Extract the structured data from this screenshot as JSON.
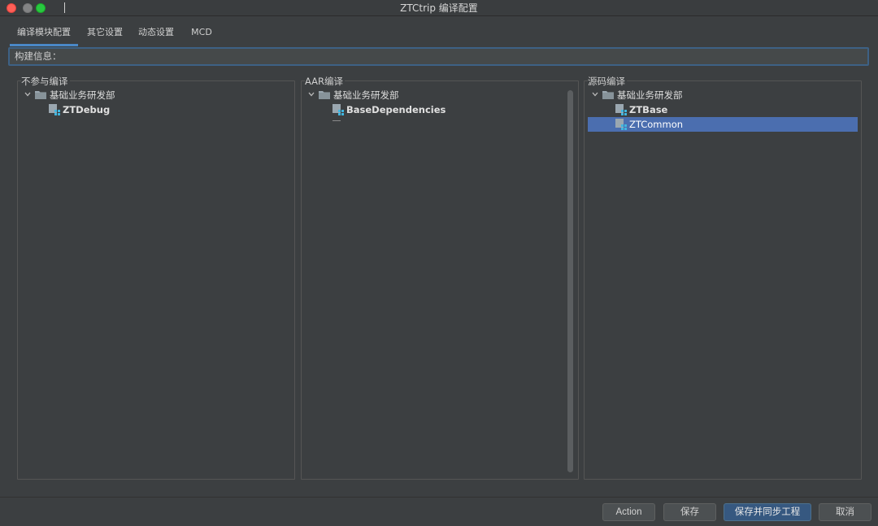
{
  "window": {
    "title": "ZTCtrip 编译配置"
  },
  "tabs": [
    {
      "label": "编译模块配置",
      "active": true
    },
    {
      "label": "其它设置",
      "active": false
    },
    {
      "label": "动态设置",
      "active": false
    },
    {
      "label": "MCD",
      "active": false
    }
  ],
  "build": {
    "label": "构建信息：",
    "value": ""
  },
  "panels": {
    "excluded": {
      "title": "不参与编译",
      "group": "基础业务研发部",
      "items": [
        "ZTDebug"
      ]
    },
    "aar": {
      "title": "AAR编译",
      "group": "基础业务研发部",
      "items": [
        "BaseDependencies"
      ]
    },
    "source": {
      "title": "源码编译",
      "group": "基础业务研发部",
      "items": [
        "ZTBase",
        "ZTCommon"
      ],
      "selected": "ZTCommon"
    }
  },
  "buttons": {
    "action": "Action",
    "save": "保存",
    "save_sync": "保存并同步工程",
    "cancel": "取消"
  },
  "colors": {
    "accent": "#4a88c7",
    "selection": "#4b6eaf",
    "primary_button": "#365880",
    "background": "#3c3f41"
  },
  "icons": {
    "folder": "folder-icon",
    "module": "module-icon",
    "expand": "chevron-down-icon"
  }
}
